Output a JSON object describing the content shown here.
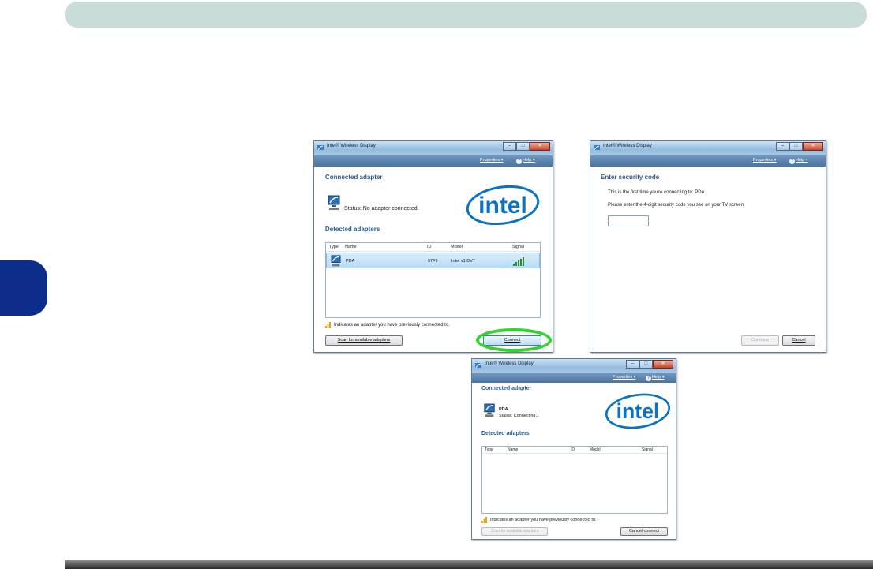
{
  "page": {
    "side_tab_color": "#0c2d8a",
    "header_bar_color": "#c9dcd8",
    "highlight_color": "#2fd42c"
  },
  "window1": {
    "title": "Intel® Wireless Display",
    "menu": {
      "properties": "Properties",
      "help": "Help"
    },
    "connected_heading": "Connected adapter",
    "status": "Status: No adapter connected.",
    "detected_heading": "Detected adapters",
    "columns": {
      "type": "Type",
      "name": "Name",
      "id": "ID",
      "model": "Model",
      "signal": "Signal"
    },
    "row": {
      "name": "PDA",
      "id": "97F9",
      "model": "Intel v1 DVT"
    },
    "note": "Indicates an adapter you have previously connected to.",
    "scan_button": "Scan for available adapters",
    "connect_button": "Connect",
    "logo_text": "intel"
  },
  "window2": {
    "title": "Intel® Wireless Display",
    "menu": {
      "properties": "Properties",
      "help": "Help"
    },
    "heading": "Enter security code",
    "line1": "This is the first time you're connecting to: PDA",
    "line2": "Please enter the 4-digit security code you see on your TV screen:",
    "code_value": "",
    "continue_button": "Continue",
    "cancel_button": "Cancel"
  },
  "window3": {
    "title": "Intel® Wireless Display",
    "menu": {
      "properties": "Properties",
      "help": "Help"
    },
    "connected_heading": "Connected adapter",
    "adapter_name": "PDA",
    "status": "Status: Connecting...",
    "detected_heading": "Detected adapters",
    "columns": {
      "type": "Type",
      "name": "Name",
      "id": "ID",
      "model": "Model",
      "signal": "Signal"
    },
    "note": "Indicates an adapter you have previously connected to.",
    "scan_button": "Scan for available adapters",
    "cancel_button": "Cancel connect",
    "logo_text": "intel"
  }
}
